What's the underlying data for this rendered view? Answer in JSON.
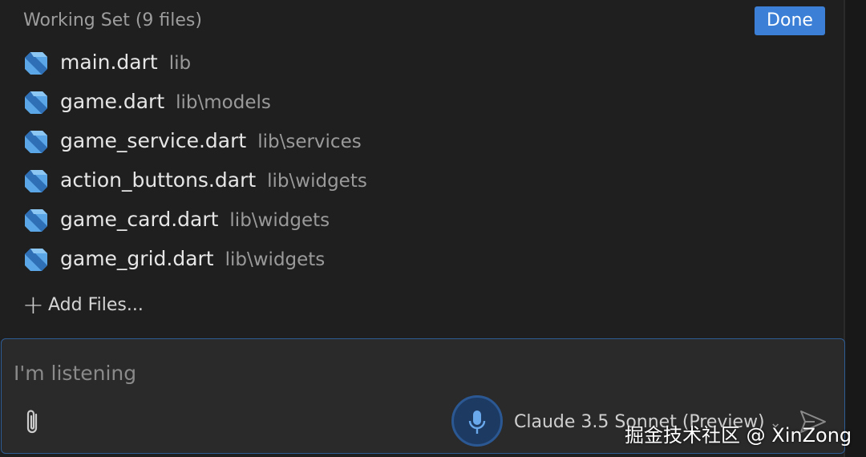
{
  "working_set": {
    "title": "Working Set (9 files)",
    "done_label": "Done",
    "files": [
      {
        "name": "main.dart",
        "path": "lib"
      },
      {
        "name": "game.dart",
        "path": "lib\\models"
      },
      {
        "name": "game_service.dart",
        "path": "lib\\services"
      },
      {
        "name": "action_buttons.dart",
        "path": "lib\\widgets"
      },
      {
        "name": "game_card.dart",
        "path": "lib\\widgets"
      },
      {
        "name": "game_grid.dart",
        "path": "lib\\widgets"
      }
    ],
    "add_files_label": "Add Files..."
  },
  "chat_input": {
    "placeholder": "I'm listening",
    "model_label": "Claude 3.5 Sonnet (Preview)",
    "icons": {
      "attach": "paperclip-icon",
      "mic": "microphone-icon",
      "send": "send-icon",
      "file": "dart-file-icon",
      "model_dropdown": "chevron-down-icon"
    }
  },
  "watermark": "掘金技术社区 @ XinZong",
  "colors": {
    "accent": "#3b7fd6",
    "dart_icon": "#5aa6e6",
    "input_border": "#2e5d95"
  }
}
